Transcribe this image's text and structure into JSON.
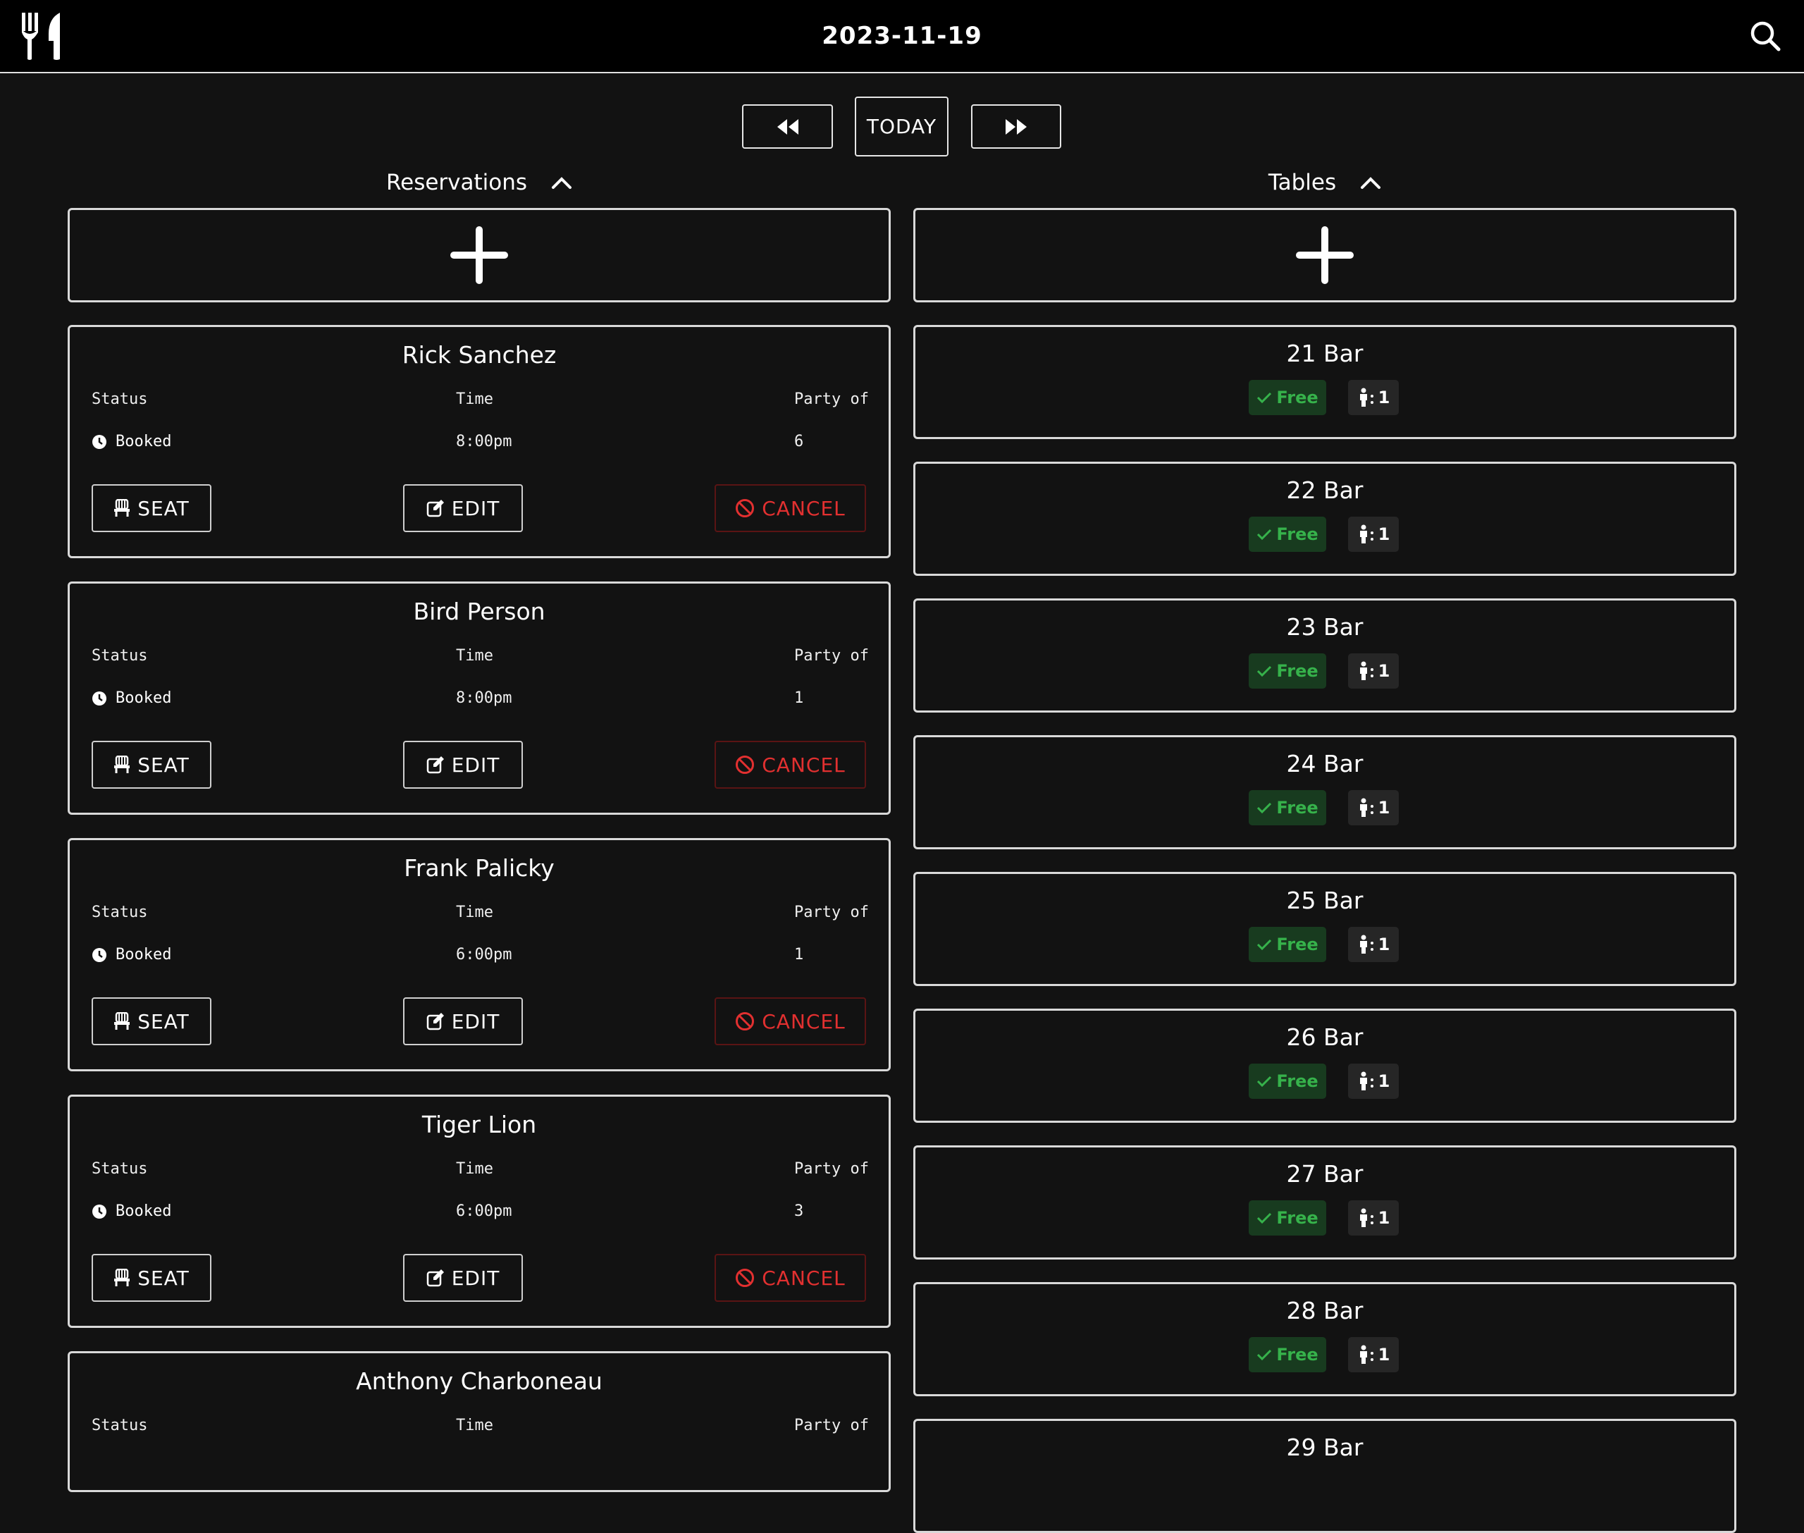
{
  "header": {
    "date": "2023-11-19"
  },
  "nav": {
    "today_label": "TODAY"
  },
  "reservations": {
    "title": "Reservations",
    "labels": {
      "status": "Status",
      "time": "Time",
      "party": "Party of"
    },
    "actions": {
      "seat": "SEAT",
      "edit": "EDIT",
      "cancel": "CANCEL"
    },
    "items": [
      {
        "name": "Rick Sanchez",
        "status": "Booked",
        "time": "8:00pm",
        "party": "6"
      },
      {
        "name": "Bird Person",
        "status": "Booked",
        "time": "8:00pm",
        "party": "1"
      },
      {
        "name": "Frank Palicky",
        "status": "Booked",
        "time": "6:00pm",
        "party": "1"
      },
      {
        "name": "Tiger Lion",
        "status": "Booked",
        "time": "6:00pm",
        "party": "3"
      },
      {
        "name": "Anthony Charboneau"
      }
    ]
  },
  "tables": {
    "title": "Tables",
    "items": [
      {
        "name": "21 Bar",
        "status": "Free",
        "capacity": "1"
      },
      {
        "name": "22 Bar",
        "status": "Free",
        "capacity": "1"
      },
      {
        "name": "23 Bar",
        "status": "Free",
        "capacity": "1"
      },
      {
        "name": "24 Bar",
        "status": "Free",
        "capacity": "1"
      },
      {
        "name": "25 Bar",
        "status": "Free",
        "capacity": "1"
      },
      {
        "name": "26 Bar",
        "status": "Free",
        "capacity": "1"
      },
      {
        "name": "27 Bar",
        "status": "Free",
        "capacity": "1"
      },
      {
        "name": "28 Bar",
        "status": "Free",
        "capacity": "1"
      },
      {
        "name": "29 Bar"
      }
    ]
  },
  "colors": {
    "background": "#121212",
    "header": "#000000",
    "free": "#36b24b",
    "free_bg": "#183b1f",
    "cancel": "#e23030"
  }
}
